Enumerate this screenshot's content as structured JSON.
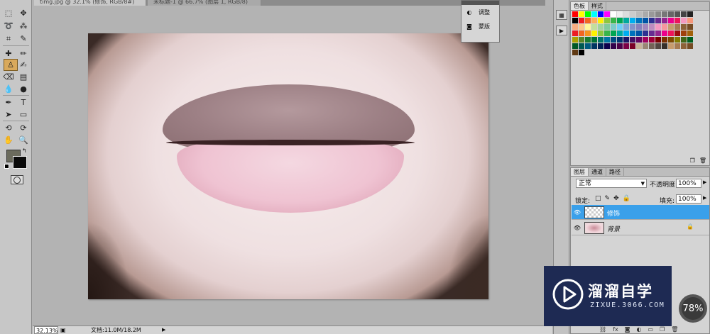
{
  "tabs": [
    {
      "label": "timg.jpg @ 32.1% (修饰, RGB/8#)"
    },
    {
      "label": "未标题-1 @ 66.7% (图层 1, RGB/8)"
    }
  ],
  "mini_panel": {
    "items": [
      {
        "label": "调整",
        "icon": "adjustment-icon"
      },
      {
        "label": "蒙版",
        "icon": "mask-icon"
      }
    ]
  },
  "status": {
    "zoom": "32.13%",
    "doc_info": "文档:11.0M/18.2M"
  },
  "swatches_panel": {
    "tabs": [
      "色板",
      "样式"
    ],
    "active_tab": "色板",
    "colors": [
      "#ff0000",
      "#ffff00",
      "#00ff00",
      "#00ffff",
      "#0000ff",
      "#ff00ff",
      "#ffffff",
      "#eeeeee",
      "#dddddd",
      "#cccccc",
      "#bbbbbb",
      "#aaaaaa",
      "#999999",
      "#888888",
      "#777777",
      "#666666",
      "#555555",
      "#444444",
      "#222222",
      "#000000",
      "#ed1c24",
      "#f26522",
      "#fbaf5d",
      "#fff200",
      "#8dc63f",
      "#39b54a",
      "#00a651",
      "#00a99d",
      "#00aeef",
      "#0072bc",
      "#0054a6",
      "#2e3192",
      "#662d91",
      "#92278f",
      "#ec008c",
      "#ed145b",
      "#f49ac1",
      "#f7977a",
      "#f9ad81",
      "#fdc68a",
      "#fff79a",
      "#c4df9b",
      "#a3d39c",
      "#82ca9c",
      "#7accc8",
      "#6dcff6",
      "#7da7d9",
      "#8393ca",
      "#8781bd",
      "#a187be",
      "#bd8cbf",
      "#f49ac2",
      "#f6989d",
      "#c69c6d",
      "#a67c52",
      "#8c6239",
      "#754c24",
      "#ed1c24",
      "#f26522",
      "#f7941d",
      "#fff200",
      "#8dc63f",
      "#39b54a",
      "#00a651",
      "#00a99d",
      "#00aeef",
      "#0072bc",
      "#0054a6",
      "#2e3192",
      "#662d91",
      "#92278f",
      "#ec008c",
      "#ed145b",
      "#9e0b0f",
      "#a0410d",
      "#a3620a",
      "#aba000",
      "#598527",
      "#1a7b30",
      "#007236",
      "#00746b",
      "#0076a3",
      "#004a80",
      "#003471",
      "#1b1464",
      "#440e62",
      "#630460",
      "#9e005d",
      "#9e0039",
      "#790000",
      "#7b2e00",
      "#7d4900",
      "#827b00",
      "#406618",
      "#005e20",
      "#005826",
      "#005952",
      "#005b7f",
      "#003663",
      "#002157",
      "#0d004c",
      "#32004b",
      "#4b0049",
      "#7b0046",
      "#7a0026",
      "#c7b299",
      "#998675",
      "#736357",
      "#534741",
      "#37302a",
      "#c69c6d",
      "#a67c52",
      "#8c6239",
      "#754c24",
      "#603913",
      "#000000"
    ]
  },
  "layers_panel": {
    "tabs": [
      "图层",
      "通道",
      "路径"
    ],
    "active_tab": "图层",
    "blend_mode": "正常",
    "opacity_label": "不透明度:",
    "opacity_value": "100%",
    "lock_label": "锁定:",
    "fill_label": "填充:",
    "fill_value": "100%",
    "layers": [
      {
        "name": "修饰",
        "selected": true,
        "visible": true
      },
      {
        "name": "背景",
        "selected": false,
        "visible": true,
        "locked": true
      }
    ]
  },
  "watermark": {
    "brand": "溜溜自学",
    "domain": "ZIXUE.3066.COM"
  },
  "progress": {
    "percent_text": "78%"
  }
}
